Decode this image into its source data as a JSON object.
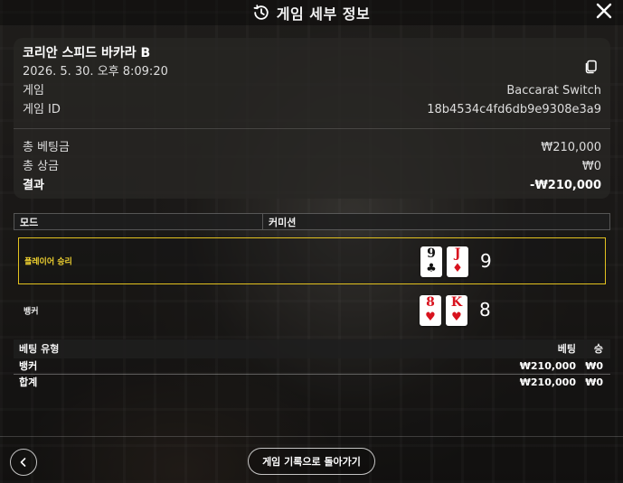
{
  "header": {
    "title": "게임 세부 정보",
    "icon": "history-icon",
    "close_icon": "close-icon"
  },
  "summary": {
    "game_name": "코리안 스피드 바카라 B",
    "datetime": "2026. 5. 30. 오후 8:09:20",
    "copy_icon": "copy-icon",
    "game_label": "게임",
    "game_value": "Baccarat Switch",
    "game_id_label": "게임 ID",
    "game_id_value": "18b4534c4fd6db9e9308e3a9",
    "total_bet_label": "총 베팅금",
    "total_bet_value": "₩210,000",
    "total_win_label": "총 상금",
    "total_win_value": "₩0",
    "result_label": "결과",
    "result_value": "-₩210,000"
  },
  "mode": {
    "mode_label": "모드",
    "commission_label": "커미션"
  },
  "results": {
    "player": {
      "label": "플레이어 승리",
      "cards": [
        {
          "rank": "9",
          "suit": "♣",
          "color": "black"
        },
        {
          "rank": "J",
          "suit": "♦",
          "color": "red"
        }
      ],
      "score": "9"
    },
    "banker": {
      "label": "뱅커",
      "cards": [
        {
          "rank": "8",
          "suit": "♥",
          "color": "red"
        },
        {
          "rank": "K",
          "suit": "♥",
          "color": "red"
        }
      ],
      "score": "8"
    }
  },
  "bets": {
    "headers": {
      "type": "베팅 유형",
      "bet": "베팅",
      "win": "승"
    },
    "rows": [
      {
        "type": "뱅커",
        "bet": "₩210,000",
        "win": "₩0"
      },
      {
        "type": "합계",
        "bet": "₩210,000",
        "win": "₩0"
      }
    ]
  },
  "footer": {
    "back_icon": "chevron-left-icon",
    "back_to_history_label": "게임 기록으로 돌아가기"
  },
  "colors": {
    "winner_highlight": "#e3c21f",
    "red_suit": "#d8121e"
  }
}
